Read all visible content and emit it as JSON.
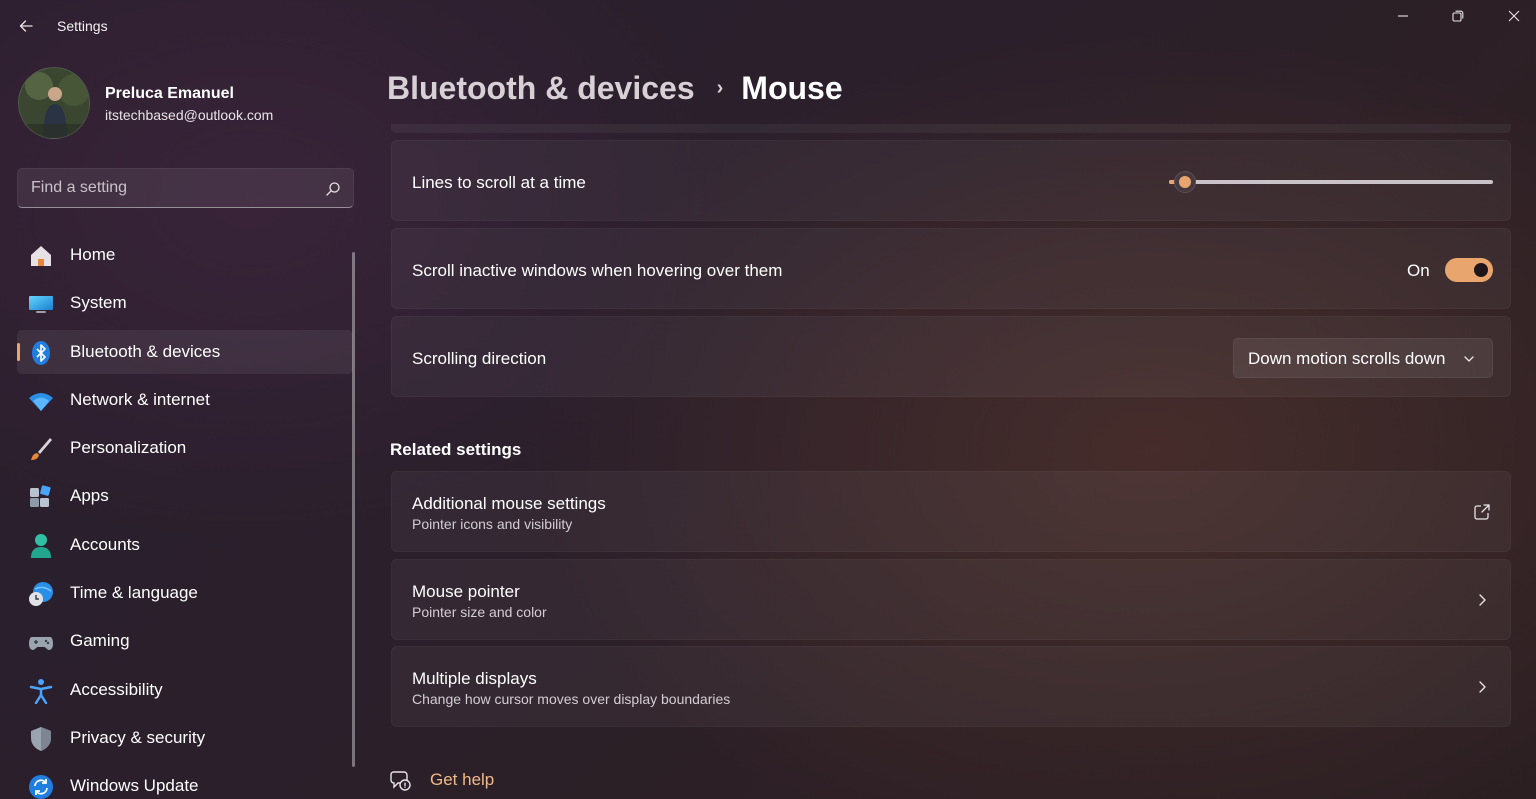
{
  "window": {
    "title": "Settings",
    "controls": [
      "minimize-icon",
      "restore-icon",
      "close-icon"
    ]
  },
  "profile": {
    "name": "Preluca Emanuel",
    "email": "itstechbased@outlook.com"
  },
  "search": {
    "placeholder": "Find a setting",
    "value": ""
  },
  "sidebar": {
    "items": [
      {
        "label": "Home",
        "icon": "home-icon",
        "selected": false
      },
      {
        "label": "System",
        "icon": "system-icon",
        "selected": false
      },
      {
        "label": "Bluetooth & devices",
        "icon": "bluetooth-icon",
        "selected": true
      },
      {
        "label": "Network & internet",
        "icon": "wifi-icon",
        "selected": false
      },
      {
        "label": "Personalization",
        "icon": "brush-icon",
        "selected": false
      },
      {
        "label": "Apps",
        "icon": "apps-icon",
        "selected": false
      },
      {
        "label": "Accounts",
        "icon": "accounts-icon",
        "selected": false
      },
      {
        "label": "Time & language",
        "icon": "globe-clock-icon",
        "selected": false
      },
      {
        "label": "Gaming",
        "icon": "gamepad-icon",
        "selected": false
      },
      {
        "label": "Accessibility",
        "icon": "accessibility-icon",
        "selected": false
      },
      {
        "label": "Privacy & security",
        "icon": "shield-icon",
        "selected": false
      },
      {
        "label": "Windows Update",
        "icon": "update-icon",
        "selected": false
      }
    ]
  },
  "header": {
    "parent": "Bluetooth & devices",
    "separator": "›",
    "current": "Mouse"
  },
  "settings": {
    "lines_to_scroll": {
      "label": "Lines to scroll at a time",
      "level": 0.05
    },
    "scroll_inactive": {
      "label": "Scroll inactive windows when hovering over them",
      "state_label": "On",
      "on": true
    },
    "scroll_direction": {
      "label": "Scrolling direction",
      "value": "Down motion scrolls down"
    }
  },
  "related": {
    "title": "Related settings",
    "items": [
      {
        "title": "Additional mouse settings",
        "subtitle": "Pointer icons and visibility",
        "action_icon": "open-external-icon"
      },
      {
        "title": "Mouse pointer",
        "subtitle": "Pointer size and color",
        "action_icon": "chevron-right-icon"
      },
      {
        "title": "Multiple displays",
        "subtitle": "Change how cursor moves over display boundaries",
        "action_icon": "chevron-right-icon"
      }
    ]
  },
  "help": {
    "label": "Get help",
    "icon": "help-chat-icon"
  },
  "colors": {
    "accent": "#e8a66e",
    "background": "#2b1f2b"
  }
}
